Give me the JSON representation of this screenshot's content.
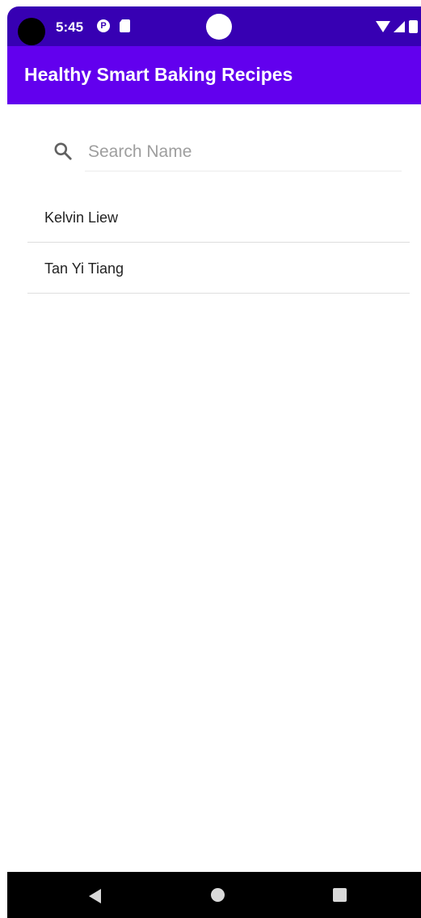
{
  "status_bar": {
    "time": "5:45",
    "p_icon_glyph": "P",
    "icons": [
      "p-notification-icon",
      "sd-card-icon",
      "wifi-icon",
      "signal-icon",
      "battery-icon"
    ]
  },
  "app_bar": {
    "title": "Healthy Smart Baking Recipes",
    "color": "#6200ee",
    "status_color": "#3700b3"
  },
  "search": {
    "placeholder": "Search Name",
    "value": "",
    "icon": "search-icon"
  },
  "list": {
    "items": [
      {
        "label": "Kelvin Liew"
      },
      {
        "label": "Tan Yi Tiang"
      }
    ]
  },
  "nav_bar": {
    "icons": [
      "back-icon",
      "home-icon",
      "recents-icon"
    ]
  }
}
